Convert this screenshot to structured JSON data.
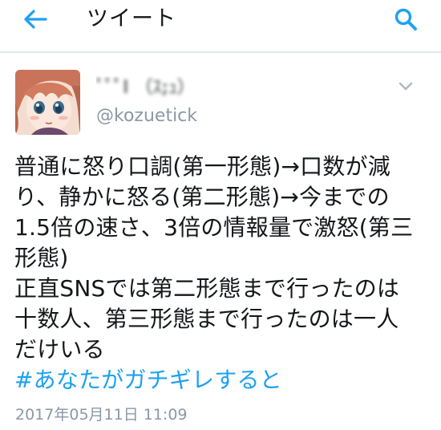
{
  "header": {
    "title": "ツイート",
    "back_icon": "arrow-left-icon",
    "search_icon": "search-icon",
    "accent_color": "#1da1f2"
  },
  "tweet": {
    "author": {
      "display_name": "ﾟﾟﾟl （ｽ;ｭ）",
      "handle": "@kozuetick",
      "avatar_icon": "anime-girl-avatar"
    },
    "menu_icon": "chevron-down-icon",
    "lines": [
      "普通に怒り口調(第一形態)→口数が減",
      "り、静かに怒る(第二形態)→今までの",
      "1.5倍の速さ、3倍の情報量で激怒(第三",
      "形態)",
      "正直SNSでは第二形態まで行ったのは",
      "十数人、第三形態まで行ったのは一人",
      "だけいる"
    ],
    "hashtag": "#あなたがガチギレすると",
    "timestamp": "2017年05月11日 11:09"
  }
}
